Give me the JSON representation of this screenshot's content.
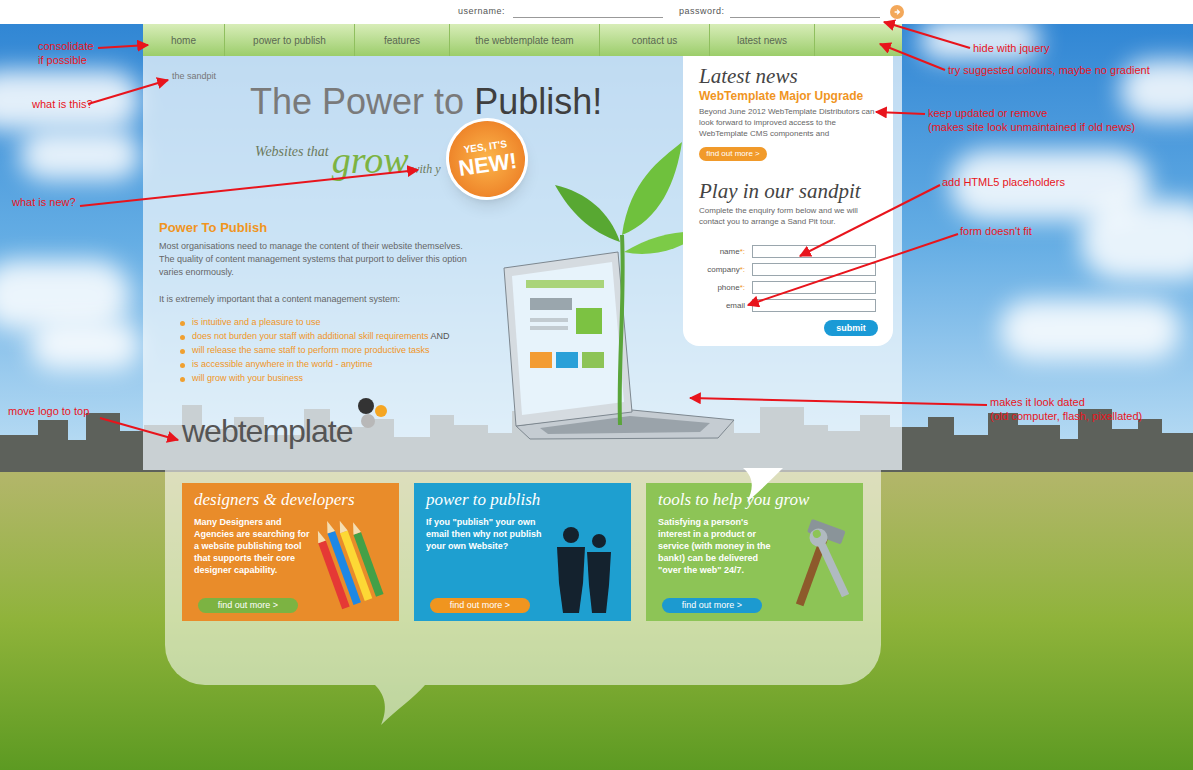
{
  "login": {
    "username_label": "username:",
    "password_label": "password:"
  },
  "nav": [
    {
      "label": "home"
    },
    {
      "label": "power to publish"
    },
    {
      "label": "features"
    },
    {
      "label": "the webtemplate team"
    },
    {
      "label": "contact us"
    },
    {
      "label": "latest news"
    }
  ],
  "hero": {
    "breadcrumb": "the sandpit",
    "title_light": "The Power to",
    "title_dark": "Publish!",
    "tagline": "Websites that",
    "tagline_accent": "grow",
    "tagline_rest": "with y",
    "badge_top": "YES, IT'S",
    "badge_main": "NEW!"
  },
  "intro": {
    "heading": "Power To Publish",
    "paragraph": "Most organisations need to manage the content of their website themselves. The quality of content management systems that purport to deliver this option varies enormously.",
    "lead": "It is extremely important that a content management system:",
    "points": [
      {
        "text": "is intuitive and a pleasure to use"
      },
      {
        "text": "does not burden your staff with additional skill requirements",
        "suffix": " AND"
      },
      {
        "text": "will release the same staff to perform more productive tasks"
      },
      {
        "text": "is accessible anywhere in the world - anytime"
      },
      {
        "text": "will grow with your business"
      }
    ]
  },
  "logo": {
    "text": "webtemplate"
  },
  "news": {
    "title": "Latest news",
    "headline": "WebTemplate Major Upgrade",
    "body": "Beyond June 2012 WebTemplate Distributors can look forward to improved access to the WebTemplate CMS components and",
    "button": "find out more >"
  },
  "sandpit": {
    "title": "Play in our sandpit",
    "intro": "Complete the enquiry form below and we will contact you to arrange a Sand Pit tour.",
    "fields": [
      {
        "label": "name",
        "marker": "*:"
      },
      {
        "label": "company",
        "marker": "*:"
      },
      {
        "label": "phone",
        "marker": "*:"
      },
      {
        "label": "email"
      }
    ],
    "submit": "submit"
  },
  "cards": [
    {
      "title": "designers & developers",
      "body": "Many Designers and Agencies are searching for a website publishing tool that supports their core designer capability.",
      "button": "find out more >",
      "color": "#e98c2a",
      "button_color": "#7cb342"
    },
    {
      "title": "power to publish",
      "body": "If you \"publish\" your own email then why not publish your own Website?",
      "button": "find out more >",
      "color": "#1e9fd0",
      "button_color": "#f0951f"
    },
    {
      "title": "tools to help you grow",
      "body": "Satisfying a person's interest in a product or service (with money in the bank!) can be  delivered \"over the web\" 24/7.",
      "button": "find out more >",
      "color": "#8dc456",
      "button_color": "#1c9ad0"
    }
  ],
  "annotations": [
    {
      "lines": [
        "consolidate",
        "if possible"
      ]
    },
    {
      "lines": [
        "what is this?"
      ]
    },
    {
      "lines": [
        "what is new?"
      ]
    },
    {
      "lines": [
        "move logo to top"
      ]
    },
    {
      "lines": [
        "hide with jquery"
      ]
    },
    {
      "lines": [
        "try suggested colours, maybe no gradient"
      ]
    },
    {
      "lines": [
        "keep updated or remove",
        "(makes site look unmaintained if old news)"
      ]
    },
    {
      "lines": [
        "add HTML5 placeholders"
      ]
    },
    {
      "lines": [
        "form doesn't fit"
      ]
    },
    {
      "lines": [
        "makes it look dated",
        "(old computer, flash, pixellated)"
      ]
    }
  ]
}
